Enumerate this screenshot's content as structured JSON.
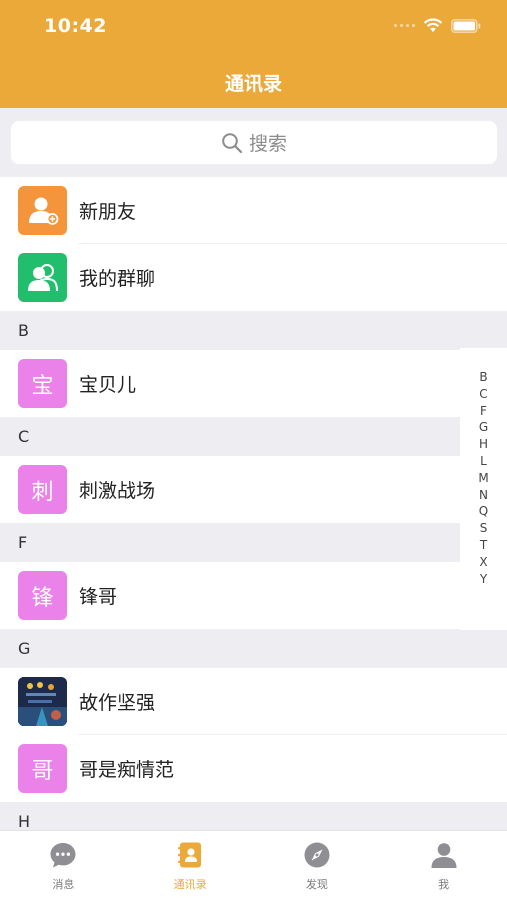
{
  "status": {
    "time": "10:42"
  },
  "nav": {
    "title": "通讯录"
  },
  "search": {
    "placeholder": "搜索"
  },
  "fixed_items": [
    {
      "label": "新朋友",
      "icon": "new-friend-icon",
      "color": "#f4953b"
    },
    {
      "label": "我的群聊",
      "icon": "group-chat-icon",
      "color": "#21bf6d"
    }
  ],
  "sections": [
    {
      "letter": "B",
      "contacts": [
        {
          "name": "宝贝儿",
          "avatar_text": "宝"
        }
      ]
    },
    {
      "letter": "C",
      "contacts": [
        {
          "name": "刺激战场",
          "avatar_text": "刺"
        }
      ]
    },
    {
      "letter": "F",
      "contacts": [
        {
          "name": "锋哥",
          "avatar_text": "锋"
        }
      ]
    },
    {
      "letter": "G",
      "contacts": [
        {
          "name": "故作坚强",
          "avatar_text": ""
        },
        {
          "name": "哥是痴情范",
          "avatar_text": "哥"
        }
      ]
    },
    {
      "letter": "H",
      "contacts": []
    }
  ],
  "index_letters": [
    "B",
    "C",
    "F",
    "G",
    "H",
    "L",
    "M",
    "N",
    "Q",
    "S",
    "T",
    "X",
    "Y"
  ],
  "tabs": [
    {
      "label": "消息",
      "icon": "chat-bubble-icon"
    },
    {
      "label": "通讯录",
      "icon": "contacts-book-icon",
      "active": true
    },
    {
      "label": "发现",
      "icon": "compass-icon"
    },
    {
      "label": "我",
      "icon": "person-icon"
    }
  ],
  "colors": {
    "accent": "#eba93a",
    "avatar": "#ea82ea",
    "background": "#eeedf2"
  }
}
